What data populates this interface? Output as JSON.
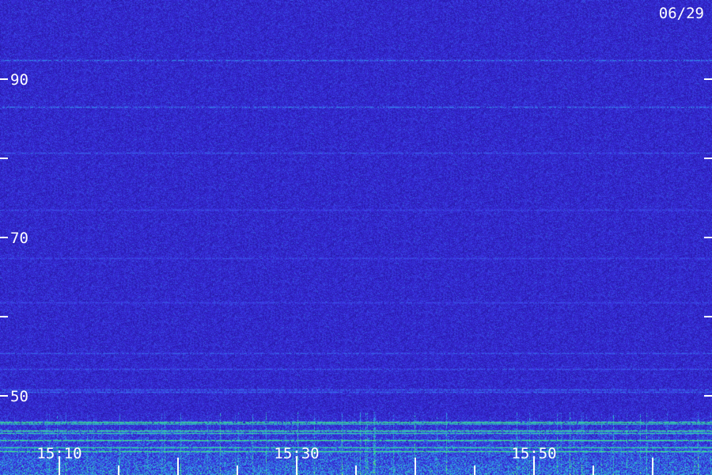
{
  "date_label": "06/29",
  "chart_data": {
    "type": "heatmap",
    "title": "",
    "xlabel": "",
    "ylabel": "",
    "y_range": [
      40,
      100
    ],
    "y_major_ticks": [
      90,
      80,
      70,
      60,
      50
    ],
    "y_tick_labels": [
      {
        "value": 90,
        "text": "90"
      },
      {
        "value": 70,
        "text": "70"
      },
      {
        "value": 50,
        "text": "50"
      }
    ],
    "x_range_minutes": [
      5,
      65
    ],
    "x_tick_labels": [
      {
        "minute": 10,
        "text": "15:10"
      },
      {
        "minute": 30,
        "text": "15:30"
      },
      {
        "minute": 50,
        "text": "15:50"
      }
    ],
    "x_minor_tick_step_minutes": 5,
    "colormap": [
      "#0d0a3c",
      "#2a1ab0",
      "#3a30e0",
      "#2fa8e8",
      "#36e87a",
      "#c6ff5a"
    ],
    "background_color": "#1a0f5e",
    "horizontal_bands": [
      {
        "value": 92.4,
        "strength": 0.35
      },
      {
        "value": 86.5,
        "strength": 0.35
      },
      {
        "value": 80.7,
        "strength": 0.25
      },
      {
        "value": 73.5,
        "strength": 0.2
      },
      {
        "value": 67.4,
        "strength": 0.2
      },
      {
        "value": 61.8,
        "strength": 0.2
      },
      {
        "value": 55.4,
        "strength": 0.25
      },
      {
        "value": 53.4,
        "strength": 0.25
      },
      {
        "value": 50.8,
        "strength": 0.3
      },
      {
        "value": 50.5,
        "strength": 0.3
      },
      {
        "value": 46.7,
        "strength": 0.85
      },
      {
        "value": 46.5,
        "strength": 0.7
      },
      {
        "value": 45.6,
        "strength": 0.85
      },
      {
        "value": 45.3,
        "strength": 0.7
      },
      {
        "value": 44.4,
        "strength": 0.85
      },
      {
        "value": 43.5,
        "strength": 0.75
      },
      {
        "value": 43.0,
        "strength": 0.85
      }
    ],
    "noise_floor_top_value": 48
  }
}
